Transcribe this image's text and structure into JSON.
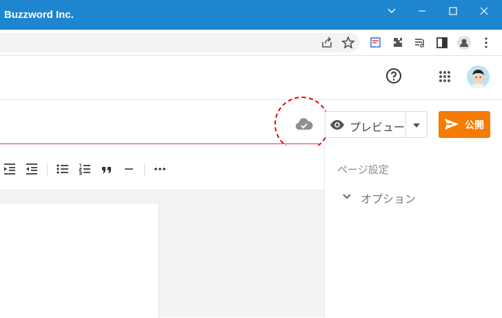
{
  "window": {
    "title": "Buzzword Inc."
  },
  "editor": {
    "preview_label": "プレビュー",
    "publish_label": "公開"
  },
  "sidebar": {
    "title": "ページ設定",
    "option_label": "オプション"
  },
  "colors": {
    "titlebar": "#1e86cf",
    "publish": "#f57c00",
    "highlight": "#e00000"
  },
  "icons": [
    "help-icon",
    "apps-grid-icon",
    "avatar",
    "cloud-check-icon",
    "eye-icon",
    "send-icon",
    "chevron-down-icon"
  ]
}
